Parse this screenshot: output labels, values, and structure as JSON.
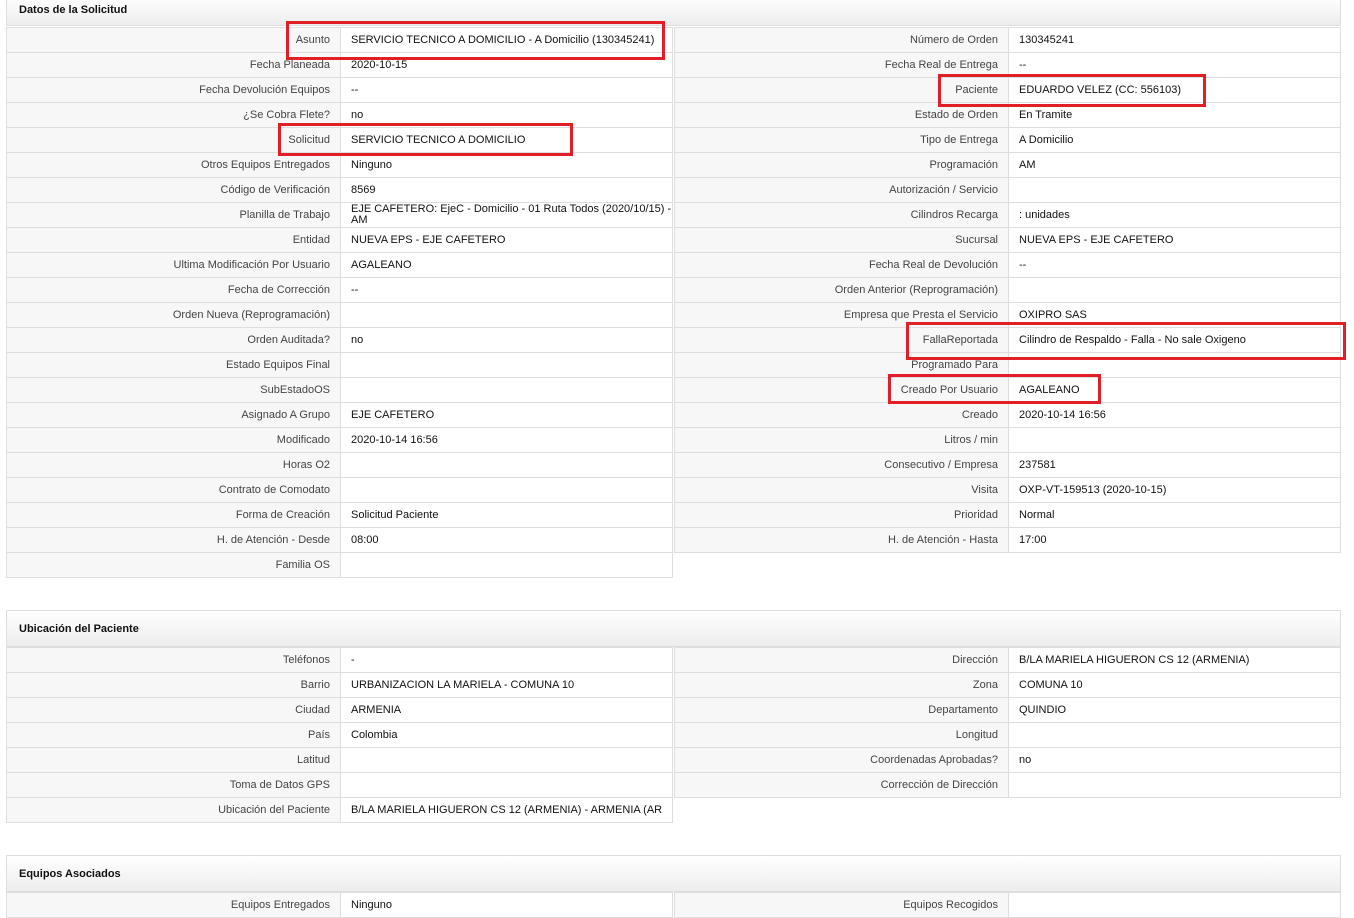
{
  "sections": {
    "solicitud": {
      "title": "Datos de la Solicitud"
    },
    "ubicacion": {
      "title": "Ubicación del Paciente"
    },
    "equipos": {
      "title": "Equipos Asociados"
    }
  },
  "solicitud_left": [
    {
      "label": "Asunto",
      "value": "SERVICIO TECNICO A DOMICILIO - A Domicilio (130345241)"
    },
    {
      "label": "Fecha Planeada",
      "value": "2020-10-15"
    },
    {
      "label": "Fecha Devolución Equipos",
      "value": "--"
    },
    {
      "label": "¿Se Cobra Flete?",
      "value": "no"
    },
    {
      "label": "Solicitud",
      "value": "SERVICIO TECNICO A DOMICILIO"
    },
    {
      "label": "Otros Equipos Entregados",
      "value": "Ninguno"
    },
    {
      "label": "Código de Verificación",
      "value": "8569"
    },
    {
      "label": "Planilla de Trabajo",
      "value": "EJE CAFETERO: EjeC - Domicilio - 01 Ruta Todos (2020/10/15) - AM"
    },
    {
      "label": "Entidad",
      "value": "NUEVA EPS - EJE CAFETERO"
    },
    {
      "label": "Ultima Modificación Por Usuario",
      "value": "AGALEANO"
    },
    {
      "label": "Fecha de Corrección",
      "value": "--"
    },
    {
      "label": "Orden Nueva (Reprogramación)",
      "value": ""
    },
    {
      "label": "Orden Auditada?",
      "value": "no"
    },
    {
      "label": "Estado Equipos Final",
      "value": ""
    },
    {
      "label": "SubEstadoOS",
      "value": ""
    },
    {
      "label": "Asignado A Grupo",
      "value": "EJE CAFETERO"
    },
    {
      "label": "Modificado",
      "value": "2020-10-14 16:56"
    },
    {
      "label": "Horas O2",
      "value": ""
    },
    {
      "label": "Contrato de Comodato",
      "value": ""
    },
    {
      "label": "Forma de Creación",
      "value": "Solicitud Paciente"
    },
    {
      "label": "H. de Atención - Desde",
      "value": "08:00"
    },
    {
      "label": "Familia OS",
      "value": ""
    }
  ],
  "solicitud_right": [
    {
      "label": "Número de Orden",
      "value": "130345241"
    },
    {
      "label": "Fecha Real de Entrega",
      "value": "--"
    },
    {
      "label": "Paciente",
      "value": "EDUARDO VELEZ (CC: 556103)"
    },
    {
      "label": "Estado de Orden",
      "value": "En Tramite"
    },
    {
      "label": "Tipo de Entrega",
      "value": "A Domicilio"
    },
    {
      "label": "Programación",
      "value": "AM"
    },
    {
      "label": "Autorización / Servicio",
      "value": ""
    },
    {
      "label": "Cilindros Recarga",
      "value": ": unidades"
    },
    {
      "label": "Sucursal",
      "value": "NUEVA EPS - EJE CAFETERO"
    },
    {
      "label": "Fecha Real de Devolución",
      "value": "--"
    },
    {
      "label": "Orden Anterior (Reprogramación)",
      "value": ""
    },
    {
      "label": "Empresa que Presta el Servicio",
      "value": "OXIPRO SAS"
    },
    {
      "label": "FallaReportada",
      "value": "Cilindro de Respaldo - Falla - No sale Oxigeno"
    },
    {
      "label": "Programado Para",
      "value": ""
    },
    {
      "label": "Creado Por Usuario",
      "value": "AGALEANO"
    },
    {
      "label": "Creado",
      "value": "2020-10-14 16:56"
    },
    {
      "label": "Litros / min",
      "value": ""
    },
    {
      "label": "Consecutivo / Empresa",
      "value": "237581"
    },
    {
      "label": "Visita",
      "value": "OXP-VT-159513 (2020-10-15)"
    },
    {
      "label": "Prioridad",
      "value": "Normal"
    },
    {
      "label": "H. de Atención - Hasta",
      "value": "17:00"
    }
  ],
  "ubicacion_left": [
    {
      "label": "Teléfonos",
      "value": "-"
    },
    {
      "label": "Barrio",
      "value": "URBANIZACION LA MARIELA - COMUNA 10"
    },
    {
      "label": "Ciudad",
      "value": "ARMENIA"
    },
    {
      "label": "País",
      "value": "Colombia"
    },
    {
      "label": "Latitud",
      "value": ""
    },
    {
      "label": "Toma de Datos GPS",
      "value": ""
    },
    {
      "label": "Ubicación del Paciente",
      "value": "B/LA MARIELA HIGUERON CS 12 (ARMENIA) - ARMENIA (AR"
    }
  ],
  "ubicacion_right": [
    {
      "label": "Dirección",
      "value": "B/LA MARIELA HIGUERON CS 12 (ARMENIA)"
    },
    {
      "label": "Zona",
      "value": "COMUNA 10"
    },
    {
      "label": "Departamento",
      "value": "QUINDIO"
    },
    {
      "label": "Longitud",
      "value": ""
    },
    {
      "label": "Coordenadas Aprobadas?",
      "value": "no"
    },
    {
      "label": "Corrección de Dirección",
      "value": ""
    }
  ],
  "equipos_left": [
    {
      "label": "Equipos Entregados",
      "value": "Ninguno"
    }
  ],
  "equipos_right": [
    {
      "label": "Equipos Recogidos",
      "value": ""
    }
  ],
  "highlight_color": "#e21f26"
}
